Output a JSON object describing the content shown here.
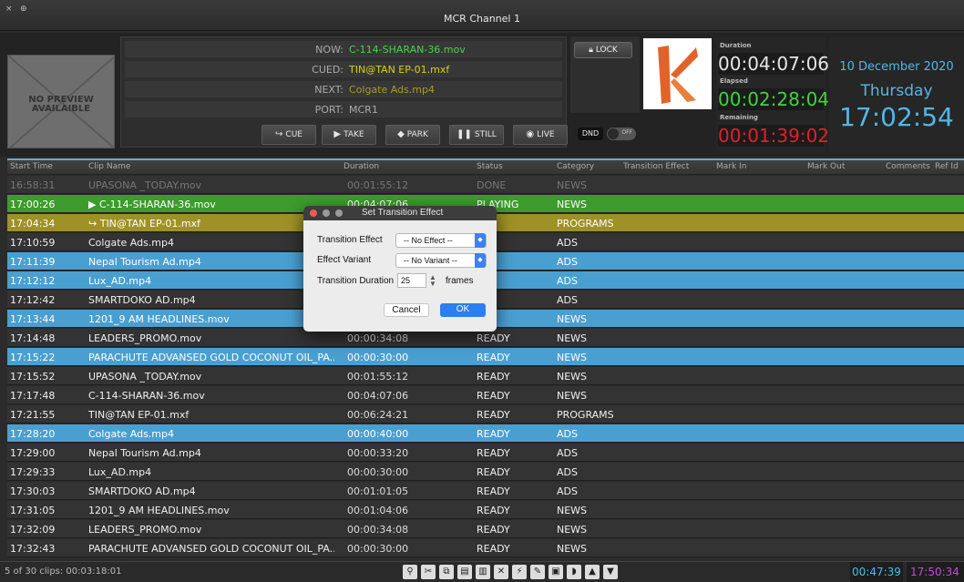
{
  "window": {
    "title": "MCR Channel 1",
    "controls": [
      "×",
      "⊕"
    ]
  },
  "preview": {
    "placeholder": "NO PREVIEW AVAILAIBLE"
  },
  "info": {
    "rows": [
      {
        "label": "NOW:",
        "value": "C-114-SHARAN-36.mov",
        "color": "#4bd24b"
      },
      {
        "label": "CUED:",
        "value": "TIN@TAN EP-01.mxf",
        "color": "#d8d300"
      },
      {
        "label": "NEXT:",
        "value": "Colgate Ads.mp4",
        "color": "#a89a2d"
      },
      {
        "label": "PORT:",
        "value": "MCR1",
        "color": "#aaaaaa"
      }
    ]
  },
  "transport": {
    "cue": "CUE",
    "take": "TAKE",
    "park": "PARK",
    "still": "STILL",
    "live": "LIVE"
  },
  "lock": {
    "label": "LOCK",
    "dnd": "DND",
    "toggle": "OFF"
  },
  "timers": {
    "duration_label": "Duration",
    "duration": "00:04:07:06",
    "elapsed_label": "Elapsed",
    "elapsed": "00:02:28:04",
    "remaining_label": "Remaining",
    "remaining": "00:01:39:02"
  },
  "date": {
    "date": "10 December 2020",
    "day": "Thursday",
    "time": "17:02:54"
  },
  "grid": {
    "headers": [
      "Start Time",
      "Clip Name",
      "Duration",
      "Status",
      "Category",
      "Transition Effect",
      "Mark In",
      "Mark Out",
      "Comments",
      "Ref Id"
    ],
    "rows": [
      {
        "start": "16:58:31",
        "clip": "UPASONA _TODAY.mov",
        "duration": "00:01:55:12",
        "status": "DONE",
        "category": "NEWS",
        "kind": "done"
      },
      {
        "start": "17:00:26",
        "clip": "C-114-SHARAN-36.mov",
        "duration": "00:04:07:06",
        "status": "PLAYING",
        "category": "NEWS",
        "kind": "playing",
        "marker": "▶"
      },
      {
        "start": "17:04:34",
        "clip": "TIN@TAN EP-01.mxf",
        "duration": "",
        "status": "D",
        "category": "PROGRAMS",
        "kind": "cued",
        "marker": "↪"
      },
      {
        "start": "17:10:59",
        "clip": "Colgate Ads.mp4",
        "duration": "",
        "status": "DY",
        "category": "ADS",
        "kind": "dark"
      },
      {
        "start": "17:11:39",
        "clip": "Nepal Tourism Ad.mp4",
        "duration": "",
        "status": "DY",
        "category": "ADS",
        "kind": "blue"
      },
      {
        "start": "17:12:12",
        "clip": "Lux_AD.mp4",
        "duration": "",
        "status": "DY",
        "category": "ADS",
        "kind": "blue"
      },
      {
        "start": "17:12:42",
        "clip": "SMARTDOKO AD.mp4",
        "duration": "",
        "status": "DY",
        "category": "ADS",
        "kind": "dark"
      },
      {
        "start": "17:13:44",
        "clip": "1201_9 AM HEADLINES.mov",
        "duration": "",
        "status": "DY",
        "category": "NEWS",
        "kind": "blue"
      },
      {
        "start": "17:14:48",
        "clip": "LEADERS_PROMO.mov",
        "duration": "00:00:34:08",
        "status": "READY",
        "category": "NEWS",
        "kind": "dark"
      },
      {
        "start": "17:15:22",
        "clip": "PARACHUTE ADVANSED GOLD COCONUT OIL_PA...",
        "duration": "00:00:30:00",
        "status": "READY",
        "category": "NEWS",
        "kind": "blue"
      },
      {
        "start": "17:15:52",
        "clip": "UPASONA _TODAY.mov",
        "duration": "00:01:55:12",
        "status": "READY",
        "category": "NEWS",
        "kind": "dark"
      },
      {
        "start": "17:17:48",
        "clip": "C-114-SHARAN-36.mov",
        "duration": "00:04:07:06",
        "status": "READY",
        "category": "NEWS",
        "kind": "dark"
      },
      {
        "start": "17:21:55",
        "clip": "TIN@TAN EP-01.mxf",
        "duration": "00:06:24:21",
        "status": "READY",
        "category": "PROGRAMS",
        "kind": "dark"
      },
      {
        "start": "17:28:20",
        "clip": "Colgate Ads.mp4",
        "duration": "00:00:40:00",
        "status": "READY",
        "category": "ADS",
        "kind": "blue"
      },
      {
        "start": "17:29:00",
        "clip": "Nepal Tourism Ad.mp4",
        "duration": "00:00:33:20",
        "status": "READY",
        "category": "ADS",
        "kind": "dark"
      },
      {
        "start": "17:29:33",
        "clip": "Lux_AD.mp4",
        "duration": "00:00:30:00",
        "status": "READY",
        "category": "ADS",
        "kind": "dark"
      },
      {
        "start": "17:30:03",
        "clip": "SMARTDOKO AD.mp4",
        "duration": "00:01:01:05",
        "status": "READY",
        "category": "ADS",
        "kind": "dark"
      },
      {
        "start": "17:31:05",
        "clip": "1201_9 AM HEADLINES.mov",
        "duration": "00:01:04:06",
        "status": "READY",
        "category": "NEWS",
        "kind": "dark"
      },
      {
        "start": "17:32:09",
        "clip": "LEADERS_PROMO.mov",
        "duration": "00:00:34:08",
        "status": "READY",
        "category": "NEWS",
        "kind": "dark"
      },
      {
        "start": "17:32:43",
        "clip": "PARACHUTE ADVANSED GOLD COCONUT OIL_PA...",
        "duration": "00:00:30:00",
        "status": "READY",
        "category": "NEWS",
        "kind": "dark"
      }
    ]
  },
  "dialog": {
    "title": "Set Transition Effect",
    "effect_label": "Transition Effect",
    "effect_value": "-- No Effect --",
    "variant_label": "Effect Variant",
    "variant_value": "-- No Variant --",
    "duration_label": "Transition Duration",
    "duration_value": "25",
    "duration_unit": "frames",
    "cancel": "Cancel",
    "ok": "OK"
  },
  "footer": {
    "clips": "5 of 30 clips: 00:03:18:01",
    "time1": "00:47:39",
    "time2": "17:50:34"
  },
  "colors": {
    "playing": "#3d9b2d",
    "cued": "#9e9126",
    "blue": "#4a9fd1",
    "dark": "#333333",
    "accent": "#3ec1ee",
    "remaining": "#e0222a",
    "elapsed": "#3fd43f"
  }
}
